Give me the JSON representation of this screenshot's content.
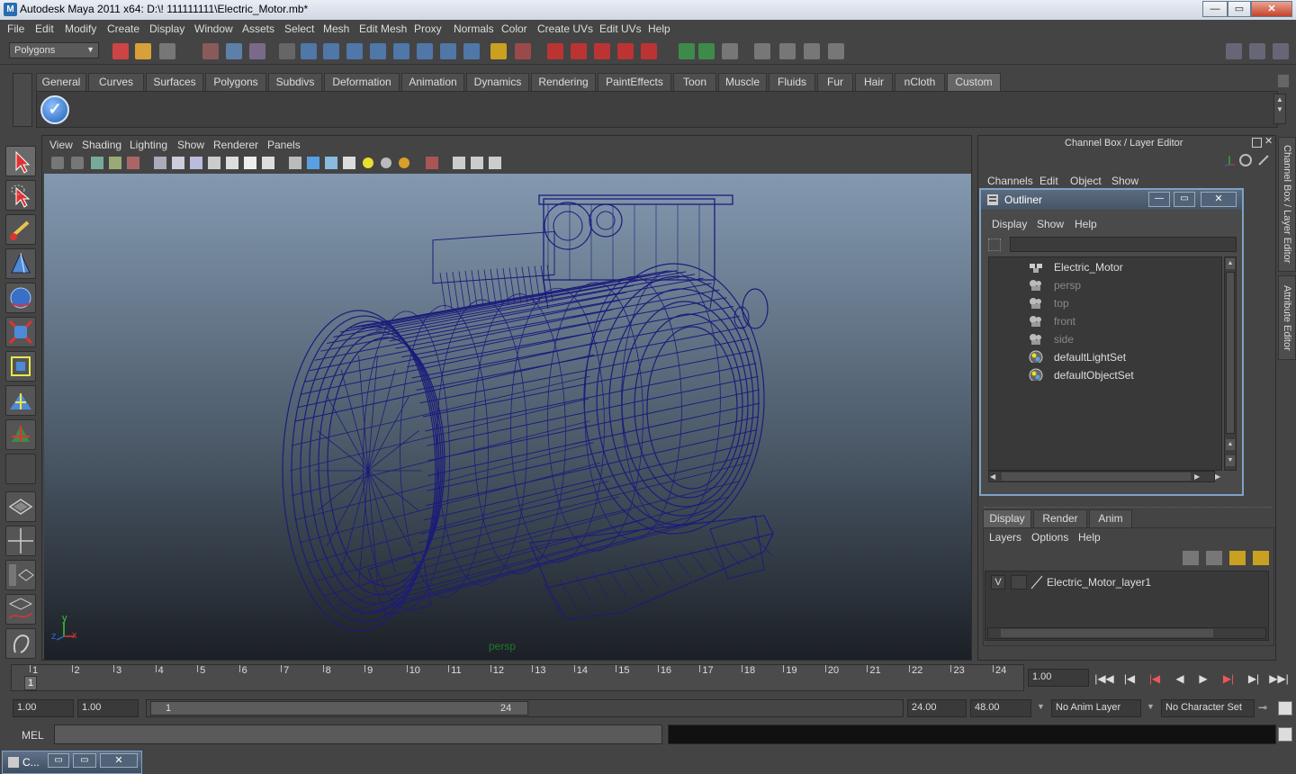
{
  "window": {
    "title": "Autodesk Maya 2011 x64: D:\\! 111111111\\Electric_Motor.mb*",
    "minimize": "—",
    "maximize": "▭",
    "close": "✕"
  },
  "menubar": [
    "File",
    "Edit",
    "Modify",
    "Create",
    "Display",
    "Window",
    "Assets",
    "Select",
    "Mesh",
    "Edit Mesh",
    "Proxy",
    "Normals",
    "Color",
    "Create UVs",
    "Edit UVs",
    "Help"
  ],
  "statusline": {
    "mode": "Polygons"
  },
  "shelf": {
    "tabs": [
      "General",
      "Curves",
      "Surfaces",
      "Polygons",
      "Subdivs",
      "Deformation",
      "Animation",
      "Dynamics",
      "Rendering",
      "PaintEffects",
      "Toon",
      "Muscle",
      "Fluids",
      "Fur",
      "Hair",
      "nCloth",
      "Custom"
    ],
    "active_tab": "Custom",
    "check_glyph": "✓"
  },
  "viewport": {
    "menu": [
      "View",
      "Shading",
      "Lighting",
      "Show",
      "Renderer",
      "Panels"
    ],
    "camera_label": "persp",
    "axis": {
      "y": "y",
      "x": "x",
      "z": "z"
    },
    "wire_color": "#1c1c7a"
  },
  "channel_box": {
    "title": "Channel Box / Layer Editor",
    "menu": [
      "Channels",
      "Edit",
      "Object",
      "Show"
    ]
  },
  "outliner": {
    "title": "Outliner",
    "menu": [
      "Display",
      "Show",
      "Help"
    ],
    "items": [
      {
        "label": "Electric_Motor",
        "dim": false,
        "icon": "group-icon"
      },
      {
        "label": "persp",
        "dim": true,
        "icon": "camera-icon"
      },
      {
        "label": "top",
        "dim": true,
        "icon": "camera-icon"
      },
      {
        "label": "front",
        "dim": true,
        "icon": "camera-icon"
      },
      {
        "label": "side",
        "dim": true,
        "icon": "camera-icon"
      },
      {
        "label": "defaultLightSet",
        "dim": false,
        "icon": "set-icon"
      },
      {
        "label": "defaultObjectSet",
        "dim": false,
        "icon": "set-icon"
      }
    ]
  },
  "layer_editor": {
    "tabs": [
      "Display",
      "Render",
      "Anim"
    ],
    "active_tab": "Display",
    "menu": [
      "Layers",
      "Options",
      "Help"
    ],
    "layers": [
      {
        "visible": "V",
        "name": "Electric_Motor_layer1"
      }
    ]
  },
  "side_tabs": [
    "Channel Box / Layer Editor",
    "Attribute Editor"
  ],
  "time_slider": {
    "start": 1,
    "end": 24,
    "current_marker": "1",
    "current_frame": "1.00"
  },
  "range_slider": {
    "start_time": "1.00",
    "playback_start": "1.00",
    "handle_start": "1",
    "handle_end": "24",
    "playback_end": "24.00",
    "end_time": "48.00",
    "anim_layer": "No Anim Layer",
    "character_set": "No Character Set"
  },
  "command_line": {
    "label": "MEL"
  },
  "minimized_window": {
    "label": "C..."
  }
}
